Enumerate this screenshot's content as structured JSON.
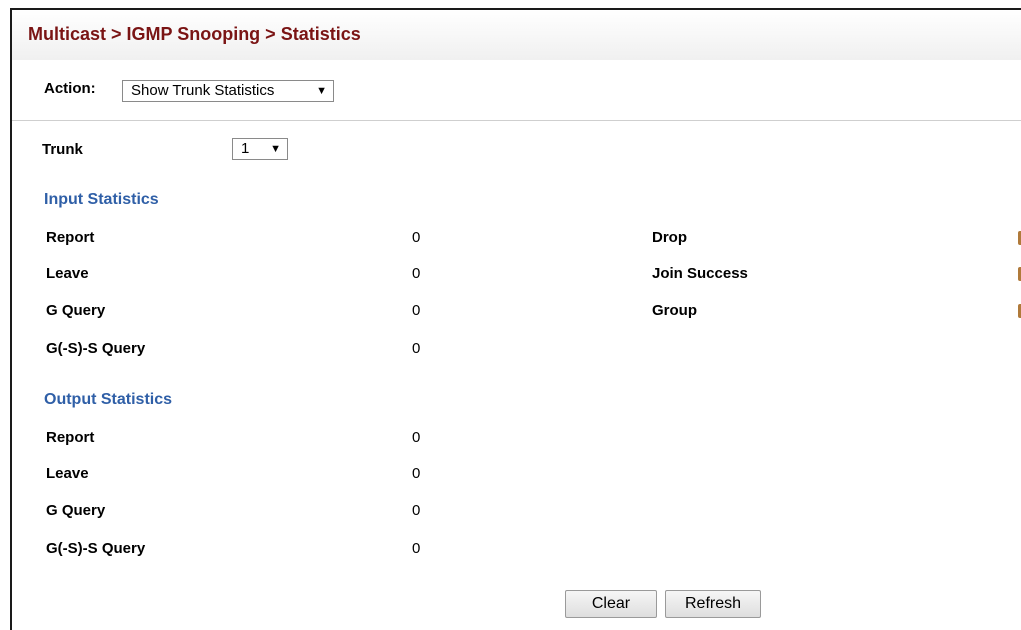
{
  "breadcrumb": "Multicast > IGMP Snooping > Statistics",
  "action": {
    "label": "Action:",
    "selected": "Show Trunk Statistics",
    "arrow": "▼"
  },
  "trunk": {
    "label": "Trunk",
    "selected": "1",
    "arrow": "▼"
  },
  "input_statistics": {
    "title": "Input Statistics",
    "left": [
      {
        "label": "Report",
        "value": "0"
      },
      {
        "label": "Leave",
        "value": "0"
      },
      {
        "label": "G Query",
        "value": "0"
      },
      {
        "label": "G(-S)-S Query",
        "value": "0"
      }
    ],
    "right": [
      {
        "label": "Drop"
      },
      {
        "label": "Join Success"
      },
      {
        "label": "Group"
      }
    ]
  },
  "output_statistics": {
    "title": "Output Statistics",
    "rows": [
      {
        "label": "Report",
        "value": "0"
      },
      {
        "label": "Leave",
        "value": "0"
      },
      {
        "label": "G Query",
        "value": "0"
      },
      {
        "label": "G(-S)-S Query",
        "value": "0"
      }
    ]
  },
  "buttons": {
    "clear": "Clear",
    "refresh": "Refresh"
  },
  "colors": {
    "title": "#7a1414",
    "section": "#2f5fa7"
  }
}
